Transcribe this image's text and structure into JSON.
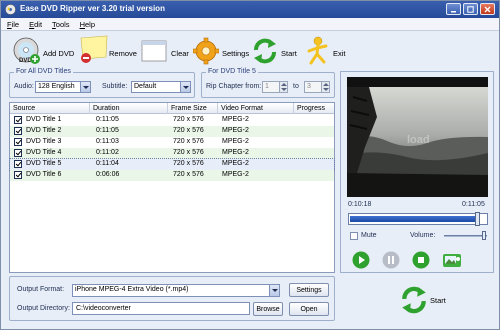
{
  "window": {
    "title": "Ease DVD Ripper ver 3.20  trial version",
    "controls": [
      "minimize-icon",
      "maximize-icon",
      "close-icon"
    ]
  },
  "menu": [
    "File",
    "Edit",
    "Tools",
    "Help"
  ],
  "toolbar": {
    "add_dvd": "Add DVD",
    "remove": "Remove",
    "clear": "Clear",
    "settings": "Settings",
    "start": "Start",
    "exit": "Exit"
  },
  "all_titles": {
    "group_label": "For All DVD Titles",
    "audio_label": "Audio:",
    "audio_value": "128 English",
    "subtitle_label": "Subtitle:",
    "subtitle_value": "Default"
  },
  "title_group": {
    "group_label": "For DVD Title 5",
    "rip_label": "Rip Chapter from:",
    "from_value": "1",
    "to_label": "to",
    "to_value": "3"
  },
  "table": {
    "columns": [
      "Source",
      "Duration",
      "Frame Size",
      "Video Format",
      "Progress"
    ],
    "rows": [
      {
        "source": "DVD Title 1",
        "duration": "0:11:05",
        "frame": "720 x 576",
        "format": "MPEG-2",
        "progress": ""
      },
      {
        "source": "DVD Title 2",
        "duration": "0:11:05",
        "frame": "720 x 576",
        "format": "MPEG-2",
        "progress": ""
      },
      {
        "source": "DVD Title 3",
        "duration": "0:11:03",
        "frame": "720 x 576",
        "format": "MPEG-2",
        "progress": ""
      },
      {
        "source": "DVD Title 4",
        "duration": "0:11:02",
        "frame": "720 x 576",
        "format": "MPEG-2",
        "progress": ""
      },
      {
        "source": "DVD Title 5",
        "duration": "0:11:04",
        "frame": "720 x 576",
        "format": "MPEG-2",
        "progress": ""
      },
      {
        "source": "DVD Title 6",
        "duration": "0:06:06",
        "frame": "720 x 576",
        "format": "MPEG-2",
        "progress": ""
      }
    ]
  },
  "output": {
    "format_label": "Output Format:",
    "format_value": "iPhone MPEG-4 Extra Video (*.mp4)",
    "settings_button": "Settings",
    "directory_label": "Output Directory:",
    "directory_value": "C:\\videoconverter",
    "browse_button": "Browse",
    "open_button": "Open"
  },
  "preview": {
    "time_current": "0:10:18",
    "time_total": "0:11:05",
    "seek_progress": 0.93,
    "mute_label": "Mute",
    "volume_label": "Volume:",
    "volume_level": 0.9,
    "controls": [
      "play-icon",
      "pause-icon",
      "stop-icon",
      "snapshot-icon"
    ]
  },
  "start_big": "Start",
  "colors": {
    "titlebar": "#2e55a4",
    "row_alt": "#eaf6e8",
    "seek_fill": "#2a5bbd",
    "play_green": "#2ea12e"
  }
}
